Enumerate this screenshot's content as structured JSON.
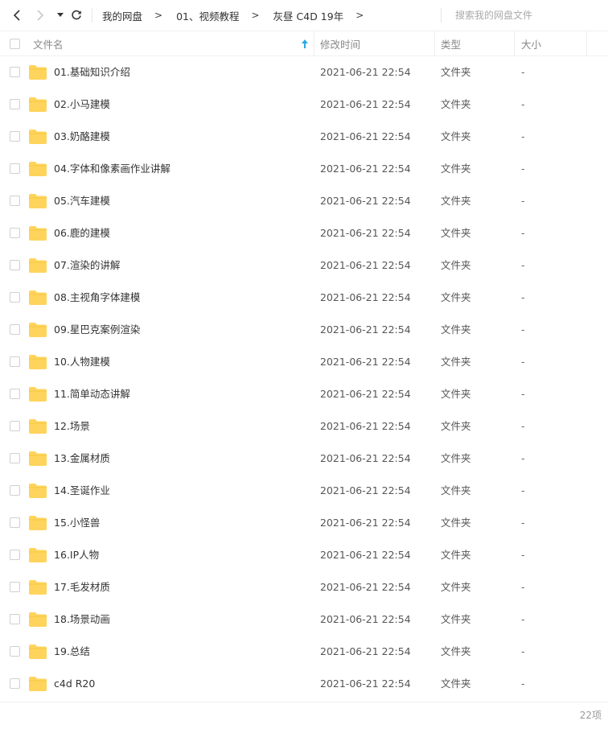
{
  "toolbar": {
    "breadcrumbs": [
      "我的网盘",
      "01、视频教程",
      "灰昼 C4D 19年"
    ],
    "separator": ">",
    "search_placeholder": "搜索我的网盘文件"
  },
  "header": {
    "name": "文件名",
    "mtime": "修改时间",
    "type": "类型",
    "size": "大小",
    "sort_icon": "sort-arrow-up-icon"
  },
  "colors": {
    "folder": "#ffd45c",
    "sort_arrow": "#2aa9e0"
  },
  "files": [
    {
      "name": "01.基础知识介绍",
      "mtime": "2021-06-21 22:54",
      "type": "文件夹",
      "size": "-"
    },
    {
      "name": "02.小马建模",
      "mtime": "2021-06-21 22:54",
      "type": "文件夹",
      "size": "-"
    },
    {
      "name": "03.奶酪建模",
      "mtime": "2021-06-21 22:54",
      "type": "文件夹",
      "size": "-"
    },
    {
      "name": "04.字体和像素画作业讲解",
      "mtime": "2021-06-21 22:54",
      "type": "文件夹",
      "size": "-"
    },
    {
      "name": "05.汽车建模",
      "mtime": "2021-06-21 22:54",
      "type": "文件夹",
      "size": "-"
    },
    {
      "name": "06.鹿的建模",
      "mtime": "2021-06-21 22:54",
      "type": "文件夹",
      "size": "-"
    },
    {
      "name": "07.渲染的讲解",
      "mtime": "2021-06-21 22:54",
      "type": "文件夹",
      "size": "-"
    },
    {
      "name": "08.主视角字体建模",
      "mtime": "2021-06-21 22:54",
      "type": "文件夹",
      "size": "-"
    },
    {
      "name": "09.星巴克案例渲染",
      "mtime": "2021-06-21 22:54",
      "type": "文件夹",
      "size": "-"
    },
    {
      "name": "10.人物建模",
      "mtime": "2021-06-21 22:54",
      "type": "文件夹",
      "size": "-"
    },
    {
      "name": "11.简单动态讲解",
      "mtime": "2021-06-21 22:54",
      "type": "文件夹",
      "size": "-"
    },
    {
      "name": "12.场景",
      "mtime": "2021-06-21 22:54",
      "type": "文件夹",
      "size": "-"
    },
    {
      "name": "13.金属材质",
      "mtime": "2021-06-21 22:54",
      "type": "文件夹",
      "size": "-"
    },
    {
      "name": "14.圣诞作业",
      "mtime": "2021-06-21 22:54",
      "type": "文件夹",
      "size": "-"
    },
    {
      "name": "15.小怪兽",
      "mtime": "2021-06-21 22:54",
      "type": "文件夹",
      "size": "-"
    },
    {
      "name": "16.IP人物",
      "mtime": "2021-06-21 22:54",
      "type": "文件夹",
      "size": "-"
    },
    {
      "name": "17.毛发材质",
      "mtime": "2021-06-21 22:54",
      "type": "文件夹",
      "size": "-"
    },
    {
      "name": "18.场景动画",
      "mtime": "2021-06-21 22:54",
      "type": "文件夹",
      "size": "-"
    },
    {
      "name": "19.总结",
      "mtime": "2021-06-21 22:54",
      "type": "文件夹",
      "size": "-"
    },
    {
      "name": "c4d R20",
      "mtime": "2021-06-21 22:54",
      "type": "文件夹",
      "size": "-"
    }
  ],
  "footer": {
    "item_count": "22项"
  }
}
